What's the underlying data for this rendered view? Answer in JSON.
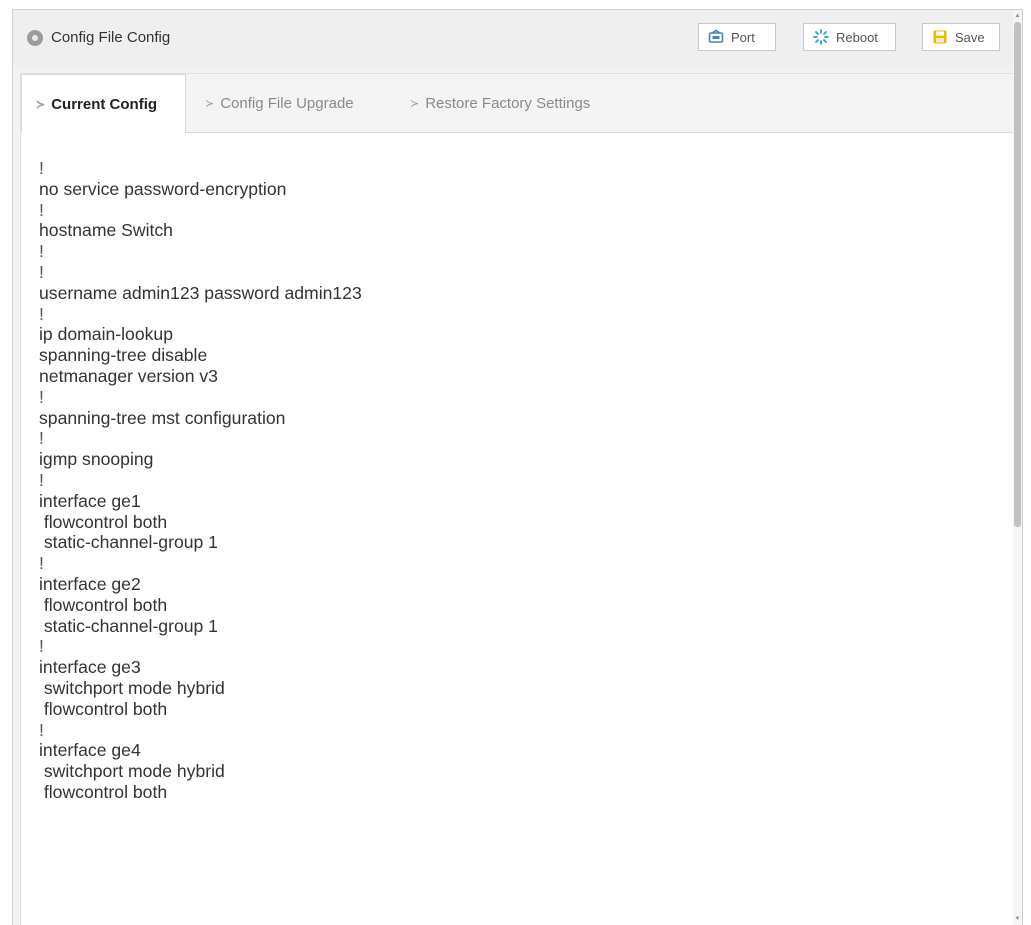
{
  "window": {
    "title": "Config File Config"
  },
  "toolbar": {
    "port_label": "Port",
    "reboot_label": "Reboot",
    "save_label": "Save"
  },
  "tabs": [
    {
      "label": "Current Config",
      "active": true
    },
    {
      "label": "Config File Upgrade",
      "active": false
    },
    {
      "label": "Restore Factory Settings",
      "active": false
    }
  ],
  "config_lines": [
    "!",
    "no service password-encryption",
    "!",
    "hostname Switch",
    "!",
    "!",
    "username admin123 password admin123",
    "!",
    "ip domain-lookup",
    "spanning-tree disable",
    "netmanager version v3",
    "!",
    "spanning-tree mst configuration",
    "!",
    "igmp snooping",
    "!",
    "interface ge1",
    " flowcontrol both",
    " static-channel-group 1",
    "!",
    "interface ge2",
    " flowcontrol both",
    " static-channel-group 1",
    "!",
    "interface ge3",
    " switchport mode hybrid",
    " flowcontrol both",
    "!",
    "interface ge4",
    " switchport mode hybrid",
    " flowcontrol both"
  ],
  "colors": {
    "accent_port": "#4a7fc1",
    "accent_reboot": "#2f9ad8",
    "accent_save": "#f2b705"
  },
  "icons": {
    "title": "status-dot-icon",
    "port": "port-icon",
    "reboot": "reboot-icon",
    "save": "save-icon"
  }
}
